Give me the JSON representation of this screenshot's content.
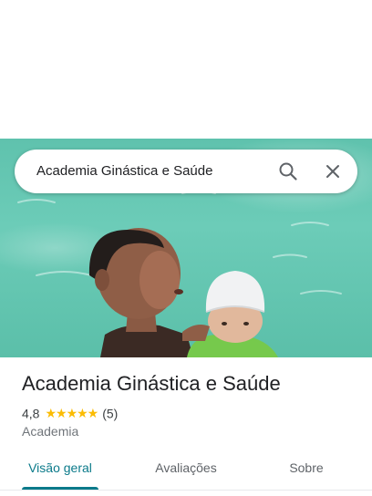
{
  "search": {
    "query": "Academia Ginástica e Saúde",
    "search_icon": "search-icon",
    "clear_icon": "close-icon"
  },
  "place": {
    "name": "Academia Ginástica e Saúde",
    "rating": "4,8",
    "stars": "★★★★★",
    "reviews_count": "(5)",
    "category": "Academia"
  },
  "tabs": [
    {
      "label": "Visão geral",
      "active": true
    },
    {
      "label": "Avaliações",
      "active": false
    },
    {
      "label": "Sobre",
      "active": false
    }
  ],
  "colors": {
    "accent": "#0b7a8a",
    "star": "#fbbc04",
    "pool_water": "#62c5b0"
  }
}
